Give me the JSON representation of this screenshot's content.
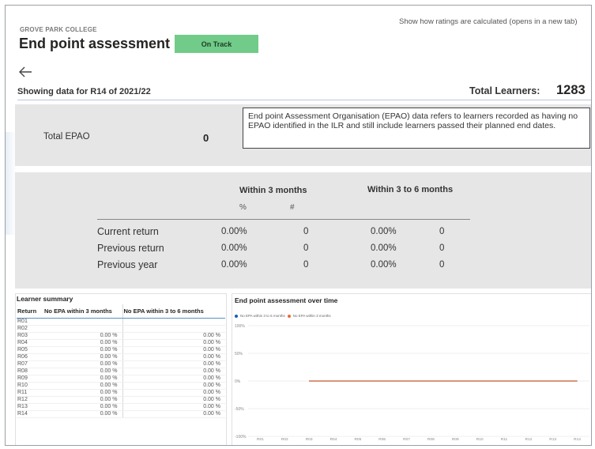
{
  "header": {
    "college": "GROVE PARK COLLEGE",
    "title": "End point assessment",
    "status": "On Track",
    "ratings_link": "Show how ratings are calculated (opens in a new tab)",
    "showing": "Showing data for R14 of 2021/22",
    "total_learners_label": "Total Learners:",
    "total_learners_value": "1283"
  },
  "colors": {
    "status_badge": "#70cc88",
    "panel_grey": "#e6e6e6",
    "series_blue": "#1f5fa8",
    "series_orange": "#e66c37"
  },
  "icons": {
    "back": "arrow-left-icon"
  },
  "epao": {
    "label": "Total EPAO",
    "value": "0",
    "description": "End point Assessment Organisation (EPAO) data refers to learners recorded as having no EPAO identified in the ILR and still include learners passed their planned end dates."
  },
  "summary": {
    "col_group_1": "Within 3 months",
    "col_group_2": "Within 3 to 6 months",
    "pct_label": "%",
    "count_label": "#",
    "rows": [
      {
        "label": "Current return",
        "pct_3": "0.00%",
        "count_3": "0",
        "pct_3_6": "0.00%",
        "count_3_6": "0"
      },
      {
        "label": "Previous return",
        "pct_3": "0.00%",
        "count_3": "0",
        "pct_3_6": "0.00%",
        "count_3_6": "0"
      },
      {
        "label": "Previous year",
        "pct_3": "0.00%",
        "count_3": "0",
        "pct_3_6": "0.00%",
        "count_3_6": "0"
      }
    ]
  },
  "learner_summary": {
    "title": "Learner summary",
    "columns": [
      "Return",
      "No EPA within 3 months",
      "No EPA within 3 to 6 months"
    ],
    "rows": [
      [
        "R01",
        "",
        ""
      ],
      [
        "R02",
        "",
        ""
      ],
      [
        "R03",
        "0.00 %",
        "0.00 %"
      ],
      [
        "R04",
        "0.00 %",
        "0.00 %"
      ],
      [
        "R05",
        "0.00 %",
        "0.00 %"
      ],
      [
        "R06",
        "0.00 %",
        "0.00 %"
      ],
      [
        "R07",
        "0.00 %",
        "0.00 %"
      ],
      [
        "R08",
        "0.00 %",
        "0.00 %"
      ],
      [
        "R09",
        "0.00 %",
        "0.00 %"
      ],
      [
        "R10",
        "0.00 %",
        "0.00 %"
      ],
      [
        "R11",
        "0.00 %",
        "0.00 %"
      ],
      [
        "R12",
        "0.00 %",
        "0.00 %"
      ],
      [
        "R13",
        "0.00 %",
        "0.00 %"
      ],
      [
        "R14",
        "0.00 %",
        "0.00 %"
      ]
    ]
  },
  "chart_data": {
    "type": "line",
    "title": "End point assessment over time",
    "categories": [
      "R01",
      "R02",
      "R03",
      "R04",
      "R05",
      "R06",
      "R07",
      "R08",
      "R09",
      "R10",
      "R11",
      "R12",
      "R13",
      "R14"
    ],
    "series": [
      {
        "name": "No EPA within 3 to 6 months",
        "color": "#1f5fa8",
        "values": [
          null,
          null,
          0,
          0,
          0,
          0,
          0,
          0,
          0,
          0,
          0,
          0,
          0,
          0
        ]
      },
      {
        "name": "No EPA within 3 months",
        "color": "#e66c37",
        "values": [
          null,
          null,
          0,
          0,
          0,
          0,
          0,
          0,
          0,
          0,
          0,
          0,
          0,
          0
        ]
      }
    ],
    "yticks": [
      "100%",
      "50%",
      "0%",
      "-50%",
      "-100%"
    ],
    "ylim": [
      -100,
      100
    ],
    "xlabel": "",
    "ylabel": "",
    "grid": true,
    "legend": "top-left"
  }
}
